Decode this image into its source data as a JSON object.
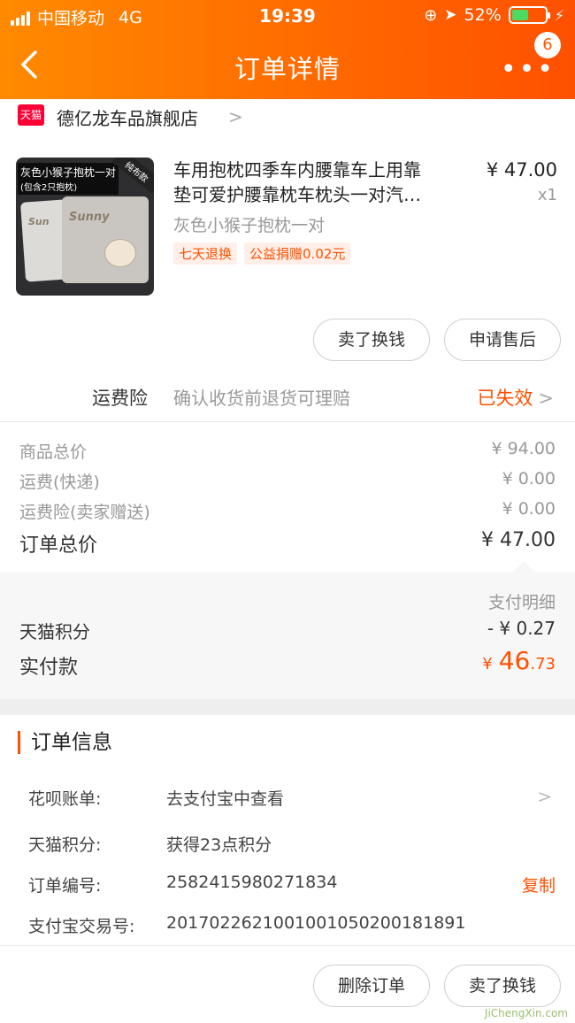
{
  "status": {
    "carrier": "中国移动",
    "network": "4G",
    "time": "19:39",
    "battery": "52%"
  },
  "nav": {
    "title": "订单详情",
    "more": "•••",
    "badge": "6"
  },
  "store": {
    "logo": "天猫",
    "name": "德亿龙车品旗舰店"
  },
  "product": {
    "title_line1": "车用抱枕四季车内腰靠车上用靠",
    "title_line2": "垫可爱护腰靠枕车枕头一对汽…",
    "price": "¥ 47.00",
    "qty": "x1",
    "sku": "灰色小猴子抱枕一对",
    "tags": [
      "七天退换",
      "公益捐赠0.02元"
    ],
    "thumb_label": "灰色小猴子抱枕一对",
    "thumb_sub": "(包含2只抱枕)",
    "thumb_corner": "纯布款",
    "thumb_brand": "Sunny"
  },
  "buttons": {
    "sell": "卖了换钱",
    "aftersale": "申请售后"
  },
  "insurance": {
    "label": "运费险",
    "desc": "确认收货前退货可理赔",
    "status": "已失效"
  },
  "costs": {
    "goods_label": "商品总价",
    "goods": "¥ 94.00",
    "shipping_label": "运费(快递)",
    "shipping": "¥ 0.00",
    "ins_label": "运费险(卖家赠送)",
    "ins": "¥ 0.00",
    "total_label": "订单总价",
    "total": "¥ 47.00"
  },
  "payment": {
    "detail_label": "支付明细",
    "points_label": "天猫积分",
    "points": "- ¥ 0.27",
    "paid_label": "实付款",
    "paid_symbol": "¥",
    "paid_int": "46",
    "paid_dec": ".73"
  },
  "order_info": {
    "title": "订单信息",
    "rows": [
      {
        "key": "花呗账单:",
        "value": "去支付宝中查看"
      },
      {
        "key": "天猫积分:",
        "value": "获得23点积分"
      },
      {
        "key": "订单编号:",
        "value": "2582415980271834"
      },
      {
        "key": "支付宝交易号:",
        "value": "2017022621001001050200181891"
      }
    ],
    "copy": "复制"
  },
  "bottom": {
    "delete": "删除订单",
    "sell": "卖了换钱"
  },
  "watermark": "JiChengXin.com"
}
